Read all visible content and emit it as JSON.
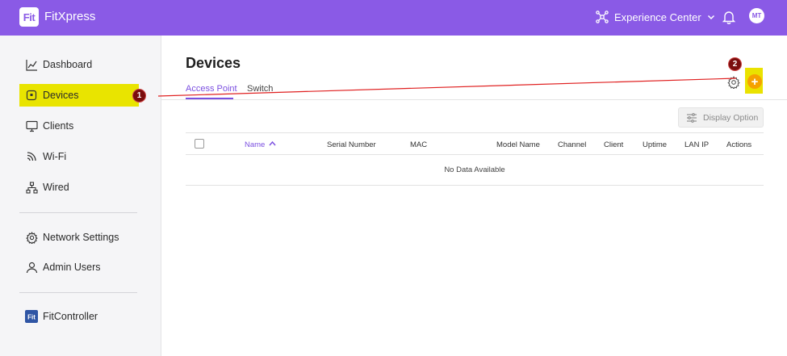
{
  "app": {
    "logo_text": "Fit",
    "title": "FitXpress"
  },
  "header": {
    "site_label": "Experience Center",
    "avatar_initials": "MT"
  },
  "sidebar": {
    "items": [
      {
        "label": "Dashboard",
        "icon": "chart-line-icon"
      },
      {
        "label": "Devices",
        "icon": "device-icon",
        "active": true
      },
      {
        "label": "Clients",
        "icon": "monitor-icon"
      },
      {
        "label": "Wi-Fi",
        "icon": "wifi-icon"
      },
      {
        "label": "Wired",
        "icon": "network-icon"
      },
      {
        "label": "Network Settings",
        "icon": "gear-icon"
      },
      {
        "label": "Admin Users",
        "icon": "user-icon"
      },
      {
        "label": "FitController",
        "icon": "fit-logo-icon"
      }
    ]
  },
  "callouts": {
    "one": "1",
    "two": "2"
  },
  "main": {
    "title": "Devices",
    "tabs": [
      {
        "label": "Access Point",
        "active": true
      },
      {
        "label": "Switch"
      }
    ],
    "display_option_label": "Display Option",
    "table": {
      "columns": [
        "Name",
        "Serial Number",
        "MAC",
        "Model Name",
        "Channel",
        "Client",
        "Uptime",
        "LAN IP",
        "Actions"
      ],
      "empty_text": "No Data Available"
    }
  },
  "colors": {
    "brand": "#8a5ae6",
    "highlight": "#e9e400",
    "add": "#f5a200",
    "callout": "#7a0d0d"
  }
}
